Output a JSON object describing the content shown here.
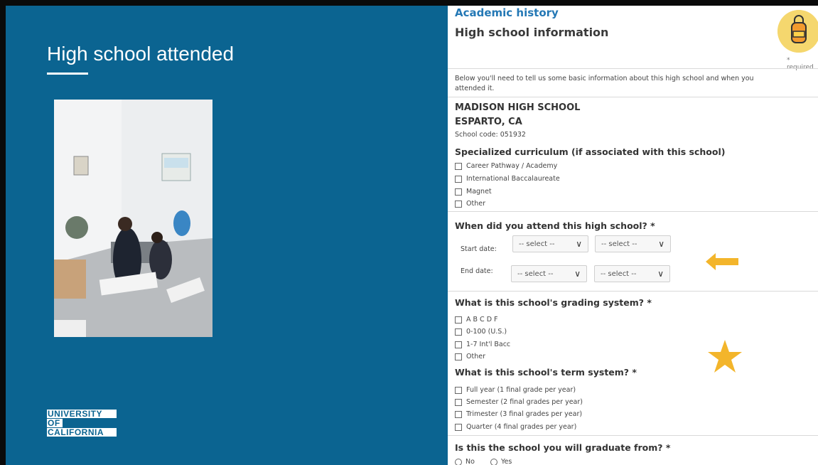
{
  "slide": {
    "title": "High school attended",
    "logo_lines": [
      "UNIVERSITY",
      "OF",
      "CALIFORNIA"
    ]
  },
  "form": {
    "section_label": "Academic history",
    "page_heading": "High school information",
    "required_note": "* required",
    "intro": "Below you'll need to tell us some basic information about this high school and when you attended it.",
    "school": {
      "name": "MADISON HIGH SCHOOL",
      "location": "ESPARTO, CA",
      "code": "School code: 051932"
    },
    "curriculum": {
      "question": "Specialized curriculum (if associated with this school)",
      "options": [
        "Career Pathway / Academy",
        "International Baccalaureate",
        "Magnet",
        "Other"
      ]
    },
    "attendance": {
      "question": "When did you attend this high school? *",
      "start_label": "Start date:",
      "end_label": "End date:",
      "select_placeholder": "-- select --"
    },
    "grading": {
      "question": "What is this school's grading system? *",
      "options": [
        "A B C D F",
        "0-100 (U.S.)",
        "1-7 Int'l Bacc",
        "Other"
      ]
    },
    "term": {
      "question": "What is this school's term system? *",
      "options": [
        "Full year (1 final grade per year)",
        "Semester (2 final grades per year)",
        "Trimester (3 final grades per year)",
        "Quarter (4 final grades per year)"
      ]
    },
    "graduate": {
      "question": "Is this the school you will graduate from? *",
      "options": [
        "No",
        "Yes"
      ]
    }
  },
  "colors": {
    "slide_blue": "#0b6491",
    "link_blue": "#2478b5",
    "annotation_orange": "#f3b52b"
  },
  "icons": {
    "badge": "backpack-icon",
    "annotation_arrow": "left-arrow-icon",
    "annotation_star": "star-icon",
    "select_chevron": "chevron-down-icon"
  }
}
